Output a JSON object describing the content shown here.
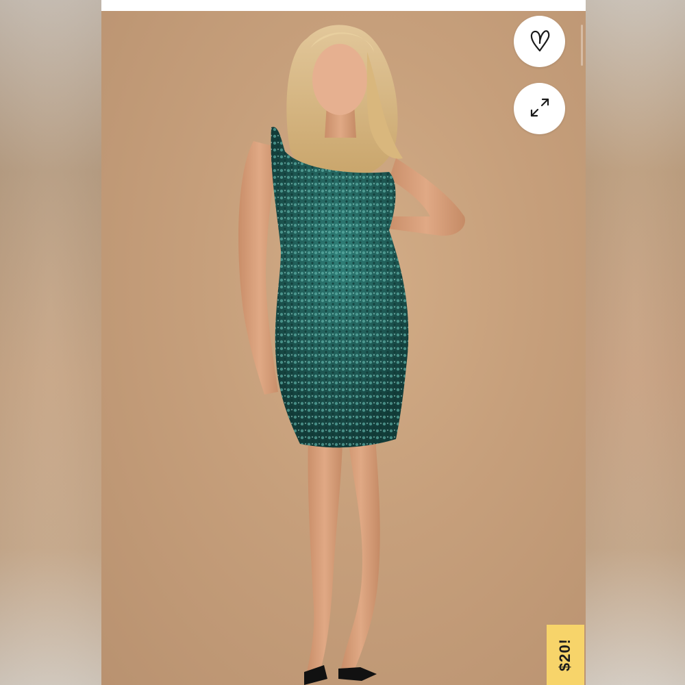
{
  "listing": {
    "price_tag": "$20!"
  },
  "actions": {
    "like_icon": "heart-outline-icon",
    "expand_icon": "expand-arrows-icon"
  },
  "colors": {
    "backdrop": "#c69f7b",
    "dress": "#1f5a55",
    "price_tag_bg": "#f7d46a"
  }
}
